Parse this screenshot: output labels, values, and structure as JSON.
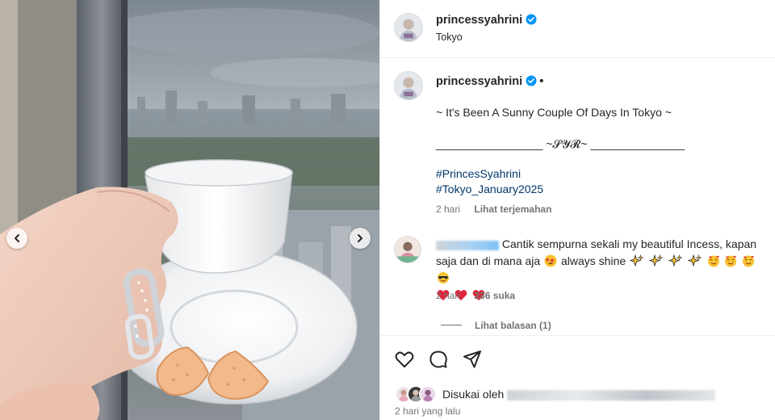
{
  "post": {
    "username": "princessyahrini",
    "location": "Tokyo",
    "verified_color": "#0095f6"
  },
  "caption": {
    "line1": "~ It's Been A Sunny Couple Of Days In Tokyo ~",
    "line2": "_________________ ~𝓢𝓨𝓡~ _______________",
    "hashtags": [
      "#PrincesSyahrini",
      "#Tokyo_January2025"
    ],
    "time": "2 hari",
    "translate_label": "Lihat terjemahan"
  },
  "comment": {
    "text_part1": "Cantik sempurna sekali my beautiful Incess, kapan saja dan di mana aja",
    "text_part2": "always shine",
    "time": "2 hari",
    "likes": "236 suka",
    "replies_label": "Lihat balasan (1)"
  },
  "actions": {
    "liked_by_prefix": "Disukai oleh",
    "date": "2 hari yang lalu"
  },
  "icons": [
    "chevron-left-icon",
    "chevron-right-icon",
    "verified-badge-icon",
    "heart-icon",
    "comment-icon",
    "share-icon"
  ],
  "colors": {
    "link": "#00376b",
    "muted": "#737373",
    "text": "#262626",
    "border": "#efefef"
  }
}
